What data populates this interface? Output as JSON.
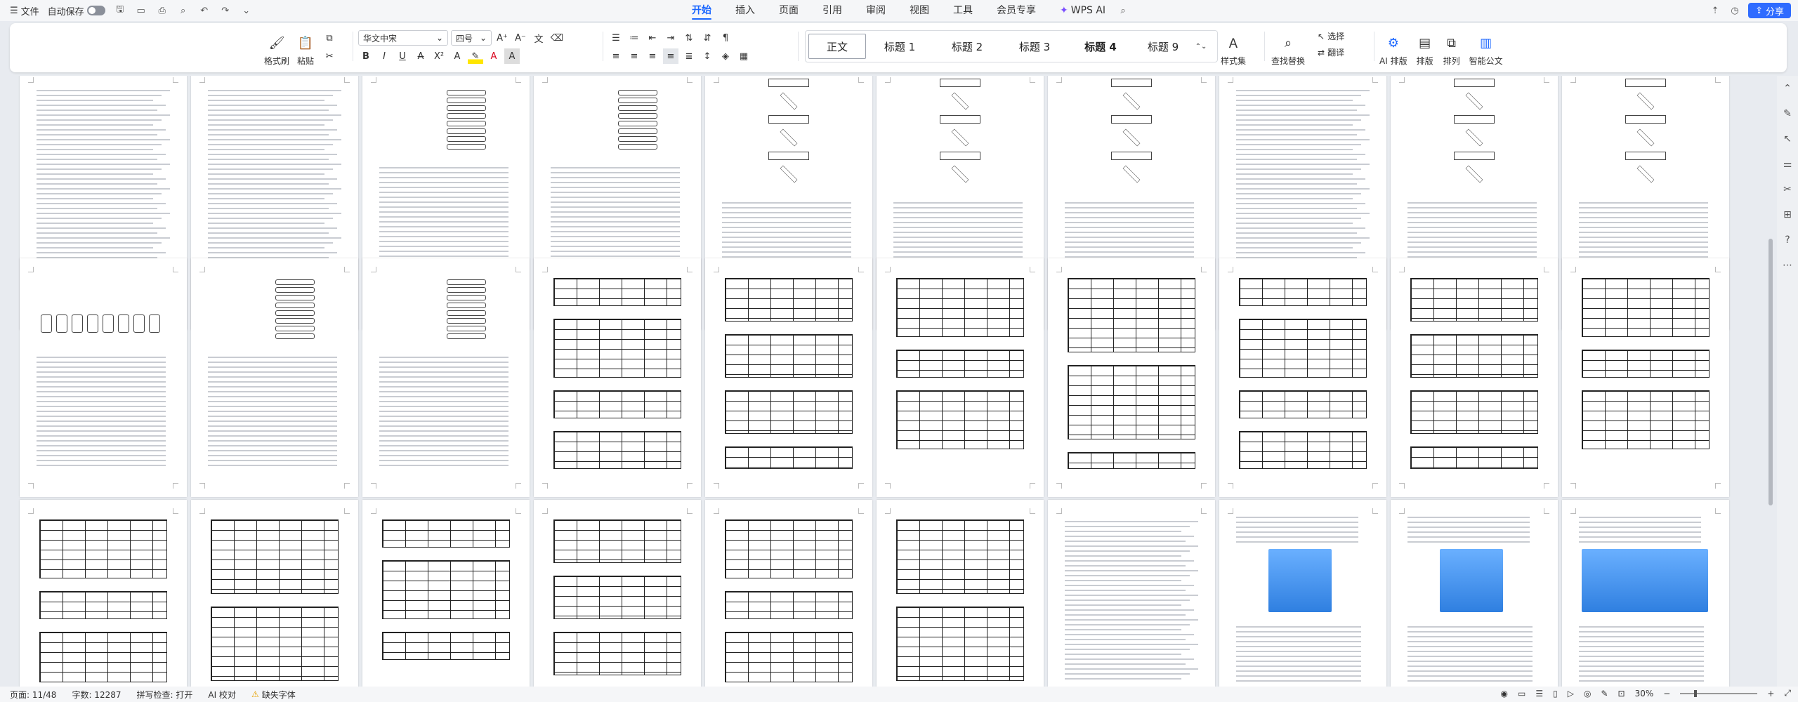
{
  "menubar": {
    "file": "文件",
    "autosave": "自动保存",
    "tabs": [
      "开始",
      "插入",
      "页面",
      "引用",
      "审阅",
      "视图",
      "工具",
      "会员专享",
      "WPS AI"
    ],
    "share": "分享"
  },
  "ribbon": {
    "format_painter": "格式刷",
    "paste": "粘贴",
    "font_name": "华文中宋",
    "font_size": "四号",
    "styles": [
      "正文",
      "标题 1",
      "标题 2",
      "标题 3",
      "标题 4",
      "标题 9"
    ],
    "style_set": "样式集",
    "find_replace": "查找替换",
    "select": "选择",
    "translate": "翻译",
    "ai_layout": "AI 排版",
    "layout": "排版",
    "arrange": "排列",
    "smart_doc": "智能公文"
  },
  "statusbar": {
    "page": "页面: 11/48",
    "words": "字数: 12287",
    "spellcheck": "拼写检查: 打开",
    "ai_check": "AI 校对",
    "missing_font": "缺失字体",
    "zoom": "30%"
  },
  "colors": {
    "accent": "#1a66ff",
    "share": "#2f6bff",
    "canvas": "#e8ebf0"
  }
}
